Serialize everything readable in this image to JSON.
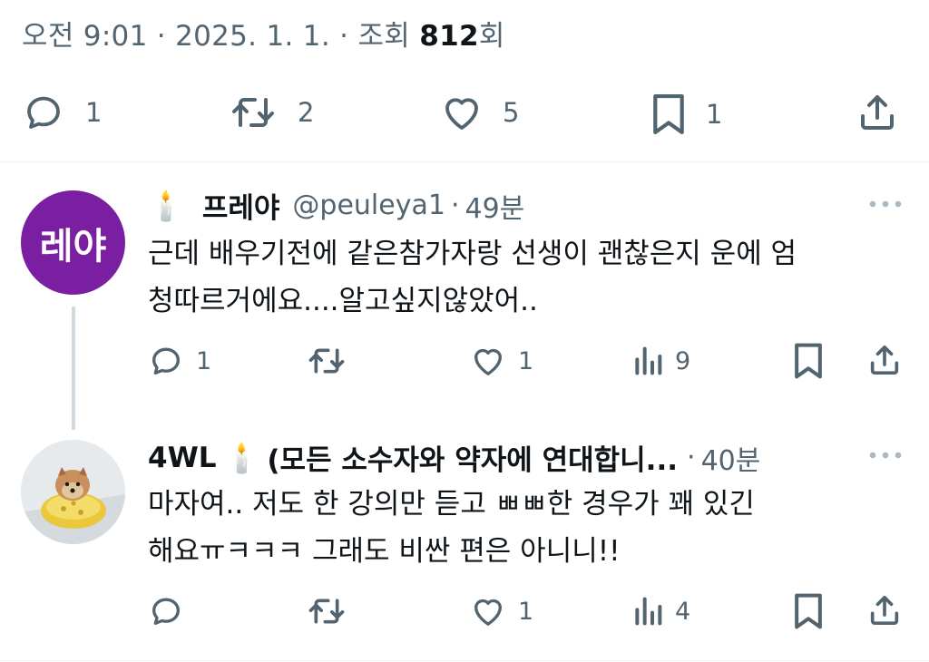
{
  "main_tweet": {
    "time": "오전 9:01",
    "date": "2025. 1. 1.",
    "views_prefix": "조회",
    "views_count": "812",
    "views_suffix": "회",
    "sep": "·",
    "actions": {
      "reply_count": "1",
      "retweet_count": "2",
      "like_count": "5",
      "bookmark_count": "1"
    }
  },
  "replies": [
    {
      "avatar_text": "레야",
      "avatar_color": "#7b1fa2",
      "emoji": "🕯️",
      "name": "프레야",
      "handle": "@peuleya1",
      "sep": "·",
      "time": "49분",
      "text_line1": "근데 배우기전에 같은참가자랑 선생이 괜찮은지 운에 엄",
      "text_line2": "청따르거에요....알고싶지않았어..",
      "reply_count": "1",
      "like_count": "1",
      "views_count": "9"
    },
    {
      "avatar_desc": "dog-photo",
      "name_prefix": "4WL",
      "emoji": "🕯️",
      "name_suffix": "(모든 소수자와 약자에 연대합니...",
      "sep": "·",
      "time": "40분",
      "text_line1": "마자여.. 저도 한 강의만 듣고 ㅃㅃ한 경우가 꽤 있긴",
      "text_line2": "해요ㅠㅋㅋㅋ 그래도 비싼 편은 아니니!!",
      "like_count": "1",
      "views_count": "4"
    }
  ],
  "colors": {
    "text_primary": "#0f1419",
    "text_secondary": "#536471",
    "divider": "#eff3f4",
    "thread_line": "#cfd9de"
  }
}
